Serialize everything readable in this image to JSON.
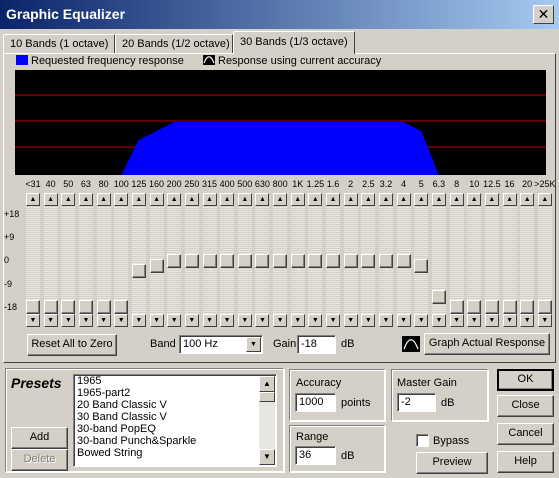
{
  "window": {
    "title": "Graphic Equalizer",
    "close_glyph": "✕"
  },
  "tabs": [
    {
      "label": "10 Bands (1 octave)",
      "active": false
    },
    {
      "label": "20 Bands (1/2 octave)",
      "active": false
    },
    {
      "label": "30 Bands (1/3 octave)",
      "active": true
    }
  ],
  "legend": {
    "requested": "Requested frequency response",
    "requested_color": "#0000ff",
    "actual": "Response using current accuracy"
  },
  "graph": {
    "background": "#000000",
    "grid_color": "#c00000",
    "fill_color": "#0000ff"
  },
  "bands": [
    {
      "label": "<31",
      "gain": -18
    },
    {
      "label": "40",
      "gain": -18
    },
    {
      "label": "50",
      "gain": -18
    },
    {
      "label": "63",
      "gain": -18
    },
    {
      "label": "80",
      "gain": -18
    },
    {
      "label": "100",
      "gain": -18
    },
    {
      "label": "125",
      "gain": -4
    },
    {
      "label": "160",
      "gain": -2
    },
    {
      "label": "200",
      "gain": 0
    },
    {
      "label": "250",
      "gain": 0
    },
    {
      "label": "315",
      "gain": 0
    },
    {
      "label": "400",
      "gain": 0
    },
    {
      "label": "500",
      "gain": 0
    },
    {
      "label": "630",
      "gain": 0
    },
    {
      "label": "800",
      "gain": 0
    },
    {
      "label": "1K",
      "gain": 0
    },
    {
      "label": "1.25",
      "gain": 0
    },
    {
      "label": "1.6",
      "gain": 0
    },
    {
      "label": "2",
      "gain": 0
    },
    {
      "label": "2.5",
      "gain": 0
    },
    {
      "label": "3.2",
      "gain": 0
    },
    {
      "label": "4",
      "gain": 0
    },
    {
      "label": "5",
      "gain": -2
    },
    {
      "label": "6.3",
      "gain": -14
    },
    {
      "label": "8",
      "gain": -18
    },
    {
      "label": "10",
      "gain": -18
    },
    {
      "label": "12.5",
      "gain": -18
    },
    {
      "label": "16",
      "gain": -18
    },
    {
      "label": "20",
      "gain": -18
    },
    {
      "label": ">25K",
      "gain": -18
    }
  ],
  "db_scale": [
    "+18",
    "+9",
    "0",
    "-9",
    "-18"
  ],
  "controls": {
    "reset_label": "Reset All to Zero",
    "band_label": "Band",
    "band_value": "100 Hz",
    "gain_label": "Gain",
    "gain_value": "-18",
    "gain_unit": "dB",
    "graph_actual_label": "Graph Actual Response"
  },
  "presets": {
    "title": "Presets",
    "items": [
      "1965",
      "1965-part2",
      "20 Band Classic V",
      "30 Band Classic V",
      "30-band PopEQ",
      "30-band Punch&Sparkle",
      "Bowed String"
    ],
    "add_label": "Add",
    "delete_label": "Delete"
  },
  "accuracy": {
    "label": "Accuracy",
    "value": "1000",
    "unit": "points"
  },
  "range": {
    "label": "Range",
    "value": "36",
    "unit": "dB"
  },
  "master_gain": {
    "label": "Master Gain",
    "value": "-2",
    "unit": "dB"
  },
  "bypass": {
    "label": "Bypass",
    "checked": false
  },
  "buttons": {
    "preview": "Preview",
    "ok": "OK",
    "close": "Close",
    "cancel": "Cancel",
    "help": "Help"
  }
}
